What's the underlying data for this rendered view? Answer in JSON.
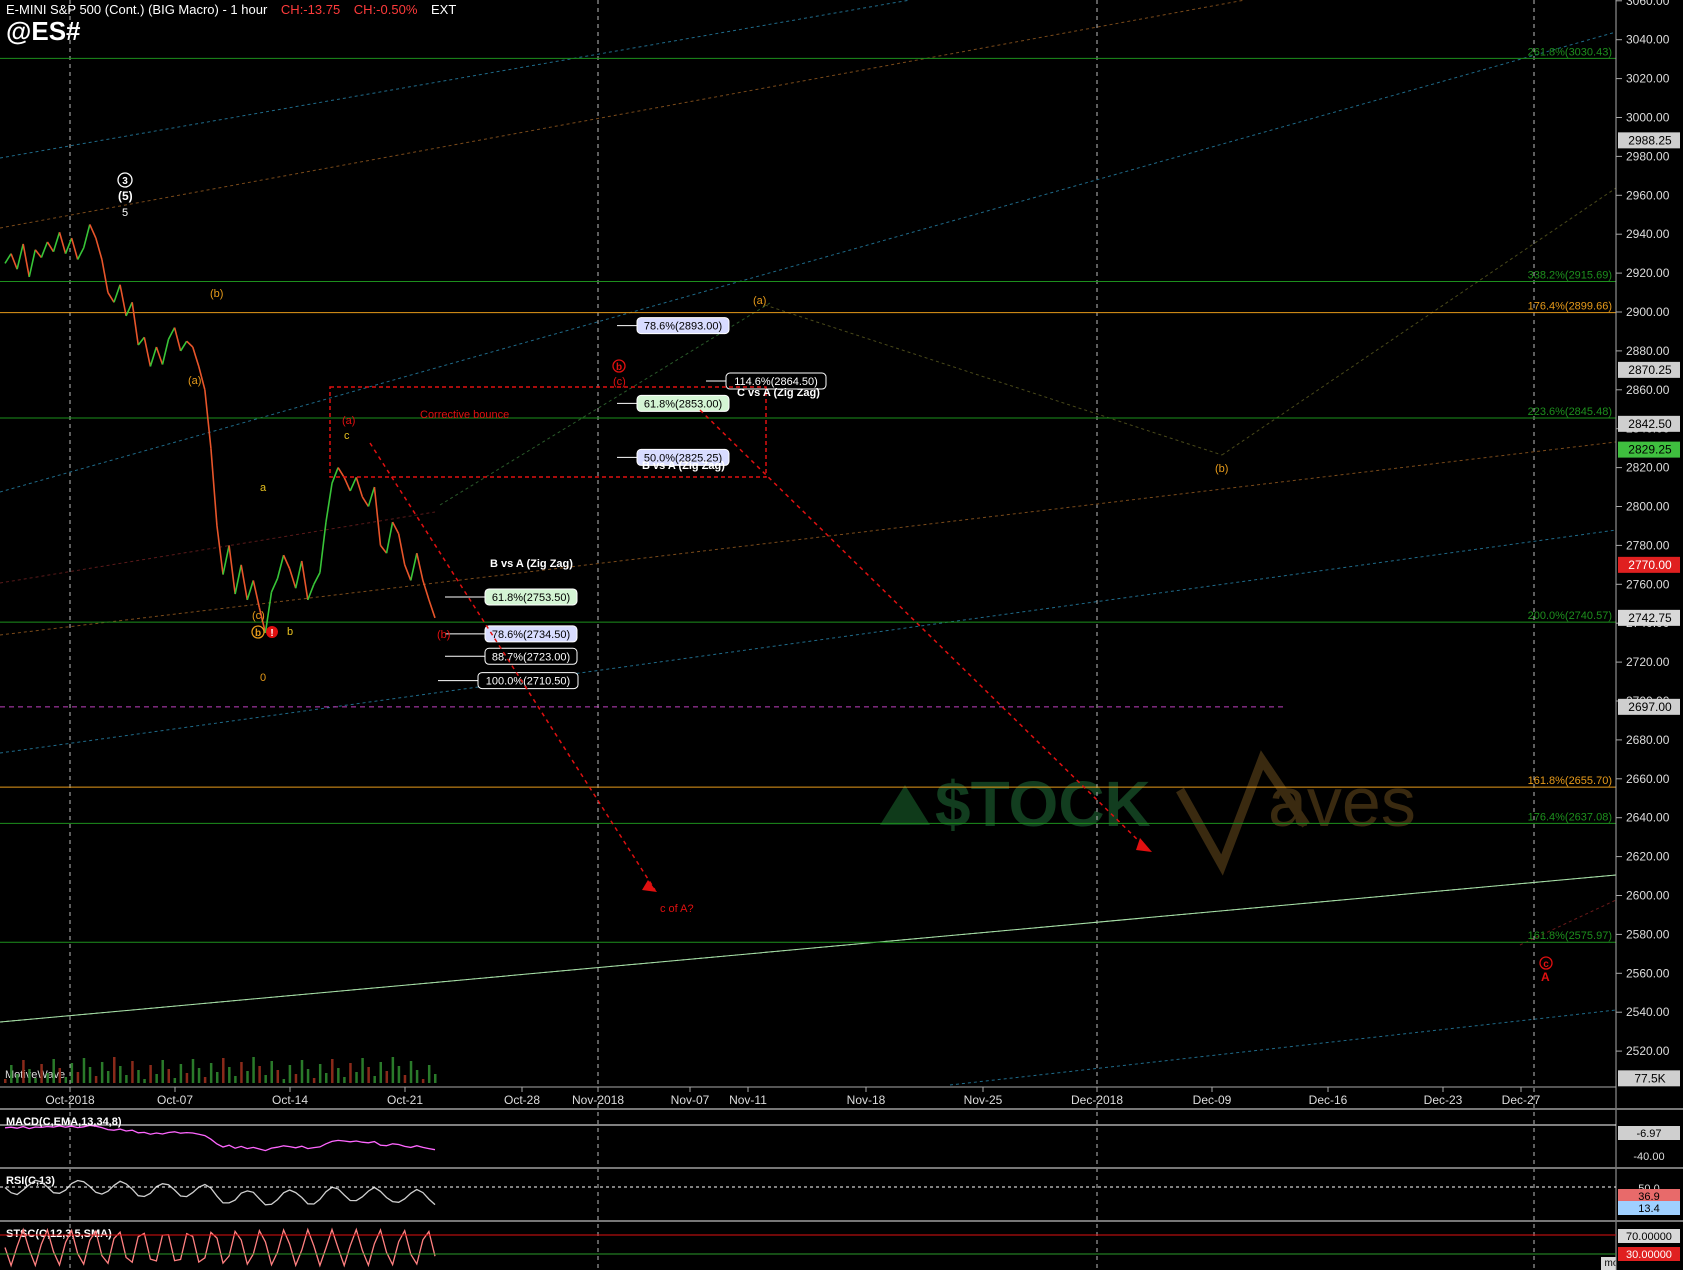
{
  "header": {
    "title": "E-MINI S&P 500 (Cont.) (BIG Macro) - 1 hour",
    "chg1": "CH:-13.75",
    "chg2": "CH:-0.50%",
    "ext": "EXT",
    "symbol": "@ES#"
  },
  "branding": {
    "motivewave": "MotiveWave",
    "footer": "motivewave.com",
    "watermark_left": "$TOCK",
    "watermark_right": "Waves"
  },
  "colors": {
    "bg": "#000000",
    "bull": "#38c538",
    "bear": "#e8552a",
    "red": "#ff2020",
    "orange": "#e69a1a",
    "green": "#1d8f1d",
    "grid": "#ffffff"
  },
  "chart_data": {
    "type": "line",
    "title": "E-MINI S&P 500 (Cont.) (BIG Macro) - 1 hour",
    "ylim": [
      2500,
      3070
    ],
    "y_ticks": [
      2520,
      2540,
      2560,
      2580,
      2600,
      2620,
      2640,
      2660,
      2680,
      2700,
      2720,
      2740,
      2760,
      2780,
      2800,
      2820,
      2840,
      2860,
      2880,
      2900,
      2920,
      2940,
      2960,
      2980,
      3000,
      3020,
      3040,
      3060
    ],
    "x_ticks": [
      "Oct-2018",
      "Oct-07",
      "Oct-14",
      "Oct-21",
      "Oct-28",
      "Nov-2018",
      "Nov-07",
      "Nov-11",
      "Nov-18",
      "Nov-25",
      "Dec-2018",
      "Dec-09",
      "Dec-16",
      "Dec-23",
      "Dec-27"
    ],
    "series": [
      {
        "values": [
          2925,
          2930,
          2922,
          2935,
          2918,
          2932,
          2928,
          2936,
          2931,
          2941,
          2930,
          2938,
          2927,
          2933,
          2945,
          2938,
          2927,
          2910,
          2905,
          2914,
          2898,
          2905,
          2883,
          2887,
          2872,
          2882,
          2873,
          2886,
          2892,
          2880,
          2885,
          2882,
          2872,
          2860,
          2830,
          2790,
          2765,
          2780,
          2755,
          2770,
          2752,
          2762,
          2748,
          2735,
          2756,
          2763,
          2775,
          2768,
          2758,
          2772,
          2752,
          2760,
          2766,
          2792,
          2812,
          2820,
          2815,
          2808,
          2815,
          2805,
          2800,
          2810,
          2780,
          2776,
          2792,
          2786,
          2770,
          2762,
          2776,
          2762,
          2752,
          2742.75
        ]
      }
    ],
    "price_labels": [
      {
        "text": "2988.25",
        "value": 2988.25,
        "bg": "#cfcfcf",
        "fg": "#000000"
      },
      {
        "text": "2870.25",
        "value": 2870.25,
        "bg": "#cfcfcf",
        "fg": "#000000"
      },
      {
        "text": "2842.50",
        "value": 2842.5,
        "bg": "#cfcfcf",
        "fg": "#000000"
      },
      {
        "text": "2829.25",
        "value": 2829.25,
        "bg": "#3fbf3f",
        "fg": "#000000"
      },
      {
        "text": "2770.00",
        "value": 2770,
        "bg": "#e02020",
        "fg": "#ffffff"
      },
      {
        "text": "2742.75",
        "value": 2742.75,
        "bg": "#d8d8d8",
        "fg": "#000000"
      },
      {
        "text": "2697.00",
        "value": 2697,
        "bg": "#cfcfcf",
        "fg": "#000000"
      },
      {
        "text": "77.5K",
        "value": 2506,
        "bg": "#cfcfcf",
        "fg": "#000000"
      }
    ],
    "fib_levels": [
      {
        "label": "261.8%(3030.43)",
        "value": 3030.43,
        "color": "#1d8f1d"
      },
      {
        "label": "338.2%(2915.69)",
        "value": 2915.69,
        "color": "#1d8f1d"
      },
      {
        "label": "176.4%(2899.66)",
        "value": 2899.66,
        "color": "#e69a1a"
      },
      {
        "label": "223.6%(2845.48)",
        "value": 2845.48,
        "color": "#1d8f1d"
      },
      {
        "label": "200.0%(2740.57)",
        "value": 2740.57,
        "color": "#1d8f1d"
      },
      {
        "label": "161.8%(2655.70)",
        "value": 2655.7,
        "color": "#e69a1a"
      },
      {
        "label": "176.4%(2637.08)",
        "value": 2637.08,
        "color": "#1d8f1d"
      },
      {
        "label": "161.8%(2575.97)",
        "value": 2575.97,
        "color": "#1d8f1d"
      }
    ],
    "retracement_boxes": [
      {
        "text": "78.6%(2893.00)",
        "value": 2893.0,
        "style": "blue"
      },
      {
        "text": "114.6%(2864.50)",
        "value": 2864.5,
        "style": "white"
      },
      {
        "text": "61.8%(2853.00)",
        "value": 2853.0,
        "style": "green"
      },
      {
        "text": "50.0%(2825.25)",
        "value": 2825.25,
        "style": "blue"
      },
      {
        "text": "61.8%(2753.50)",
        "value": 2753.5,
        "style": "green"
      },
      {
        "text": "78.6%(2734.50)",
        "value": 2734.5,
        "style": "blue"
      },
      {
        "text": "88.7%(2723.00)",
        "value": 2723.0,
        "style": "white"
      },
      {
        "text": "100.0%(2710.50)",
        "value": 2710.5,
        "style": "white"
      }
    ],
    "annotations": {
      "c_vs_a": "C vs A (Zig Zag)",
      "b_vs_a_upper": "B vs A (Zig Zag)",
      "b_vs_a_lower": "B vs A (Zig Zag)",
      "corrective_bounce": "Corrective bounce",
      "c_of_a": "c of A?",
      "wave_3": "3",
      "wave_5_paren": "(5)",
      "wave_5": "5",
      "wave_b_orange_1": "(b)",
      "wave_a_orange_1": "(a)",
      "wave_a_yellow": "a",
      "wave_c_orange": "(c)",
      "wave_c_yellow": "c",
      "wave_b_yellow": "b",
      "wave_a_red_1": "(a)",
      "wave_b_red": "(b)",
      "wave_b_circle": "b",
      "wave_c_circle": "c",
      "wave_c_paren_red": "(c)",
      "wave_a_orange_2": "(a)",
      "wave_b_orange_2": "(b)",
      "wave_big_c": "c",
      "wave_big_a": "A",
      "wave_zero": "0"
    }
  },
  "indicators": {
    "macd": {
      "label": "MACD(C,EMA,13,34,8)",
      "value": "-6.97",
      "tick": "-40.00"
    },
    "rsi": {
      "label": "RSI(C,13)",
      "tick": "50.0",
      "value1": "36.9",
      "value2": "13.4"
    },
    "stoch": {
      "label": "STSC(C,12,3,5,SMA)",
      "value1": "70.00000",
      "value2": "30.00000"
    }
  }
}
